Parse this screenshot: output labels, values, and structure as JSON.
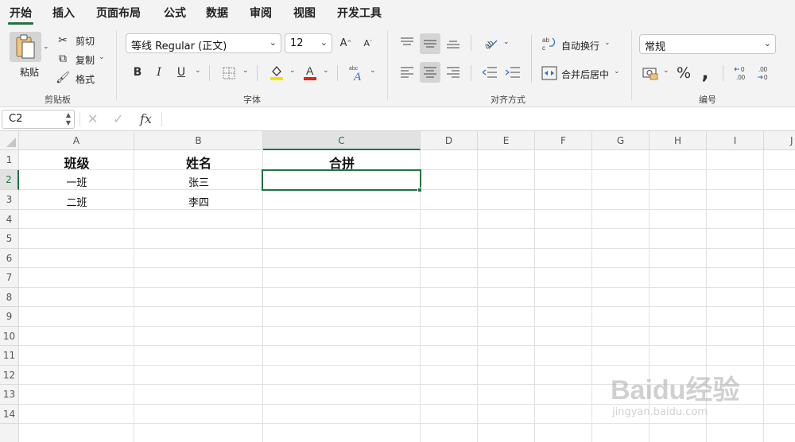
{
  "tabs": [
    "开始",
    "插入",
    "页面布局",
    "公式",
    "数据",
    "审阅",
    "视图",
    "开发工具"
  ],
  "clipboard": {
    "paste_label": "粘贴",
    "cut_label": "剪切",
    "copy_label": "复制",
    "format_label": "格式",
    "group_label": "剪贴板"
  },
  "font": {
    "font_name": "等线 Regular (正文)",
    "font_size": "12",
    "group_label": "字体",
    "bold": "B",
    "italic": "I",
    "underline": "U",
    "highlight_color": "#f5e100",
    "font_color": "#e2231a"
  },
  "alignment": {
    "wrap_label": "自动换行",
    "merge_label": "合并后居中",
    "group_label": "对齐方式"
  },
  "number": {
    "format_value": "常规",
    "percent": "%",
    "comma": ",",
    "group_label": "编号"
  },
  "formula_bar": {
    "name_box": "C2",
    "fx": "fx",
    "content": ""
  },
  "sheet": {
    "columns": [
      "A",
      "B",
      "C",
      "D",
      "E",
      "F",
      "G",
      "H",
      "I",
      "J"
    ],
    "rows": [
      "1",
      "2",
      "3",
      "4",
      "5",
      "6",
      "7",
      "8",
      "9",
      "10",
      "11",
      "12",
      "13",
      "14"
    ],
    "cells": {
      "A1": "班级",
      "B1": "姓名",
      "C1": "合拼",
      "A2": "一班",
      "B2": "张三",
      "A3": "二班",
      "B3": "李四"
    },
    "selected_cell": "C2",
    "accent_color": "#217346"
  },
  "watermark": {
    "text": "Baidu经验",
    "url": "jingyan.baidu.com"
  }
}
